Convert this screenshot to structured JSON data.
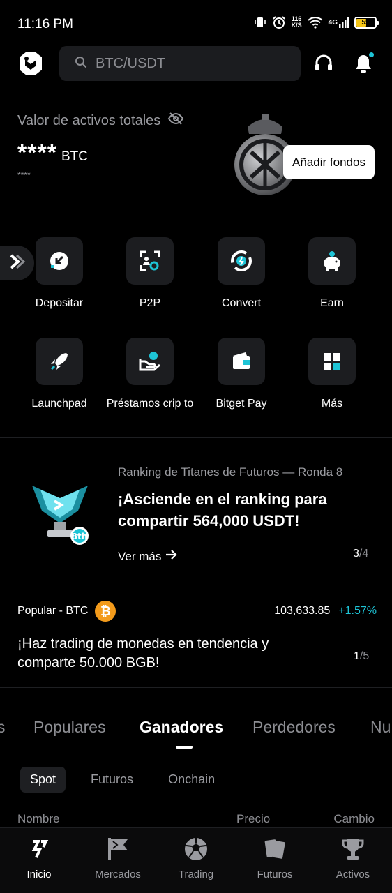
{
  "status_bar": {
    "time": "11:16 PM",
    "net_speed_value": "116",
    "net_speed_unit": "K/S",
    "network_type": "4G",
    "battery_level": "55"
  },
  "header": {
    "search_placeholder": "BTC/USDT"
  },
  "assets": {
    "label": "Valor de activos totales",
    "balance_masked": "****",
    "balance_unit": "BTC",
    "sub_balance_masked": "****",
    "add_funds_label": "Añadir fondos"
  },
  "quick_actions": [
    {
      "label": "Depositar",
      "icon": "deposit-icon"
    },
    {
      "label": "P2P",
      "icon": "p2p-icon"
    },
    {
      "label": "Convert",
      "icon": "convert-icon"
    },
    {
      "label": "Earn",
      "icon": "piggy-bank-icon"
    },
    {
      "label": "Launchpad",
      "icon": "rocket-icon"
    },
    {
      "label": "Préstamos crip to",
      "icon": "loan-icon"
    },
    {
      "label": "Bitget Pay",
      "icon": "wallet-icon"
    },
    {
      "label": "Más",
      "icon": "grid-more-icon"
    }
  ],
  "promo": {
    "kicker": "Ranking de Titanes de Futuros — Ronda 8",
    "headline": "¡Asciende en el ranking para compartir 564,000 USDT!",
    "more_label": "Ver más",
    "page_current": "3",
    "page_total": "/4",
    "trophy_badge": "8th"
  },
  "popular": {
    "tag": "Popular - BTC",
    "price": "103,633.85",
    "change": "+1.57%",
    "message": "¡Haz trading de monedas en tendencia y comparte 50.000 BGB!",
    "page_current": "1",
    "page_total": "/5"
  },
  "market_tabs": [
    "s",
    "Populares",
    "Ganadores",
    "Perdedores",
    "Nu"
  ],
  "market_subtabs": [
    "Spot",
    "Futuros",
    "Onchain"
  ],
  "table_header": {
    "name": "Nombre",
    "price": "Precio",
    "change": "Cambio"
  },
  "bottom_nav": [
    {
      "label": "Inicio",
      "icon": "home-logo-icon"
    },
    {
      "label": "Mercados",
      "icon": "flag-icon"
    },
    {
      "label": "Trading",
      "icon": "soccer-ball-icon"
    },
    {
      "label": "Futuros",
      "icon": "cards-icon"
    },
    {
      "label": "Activos",
      "icon": "trophy-icon"
    }
  ],
  "colors": {
    "accent": "#1ec4d6",
    "background": "#000000",
    "surface": "#1c1d20",
    "bitcoin": "#f39b1b"
  }
}
